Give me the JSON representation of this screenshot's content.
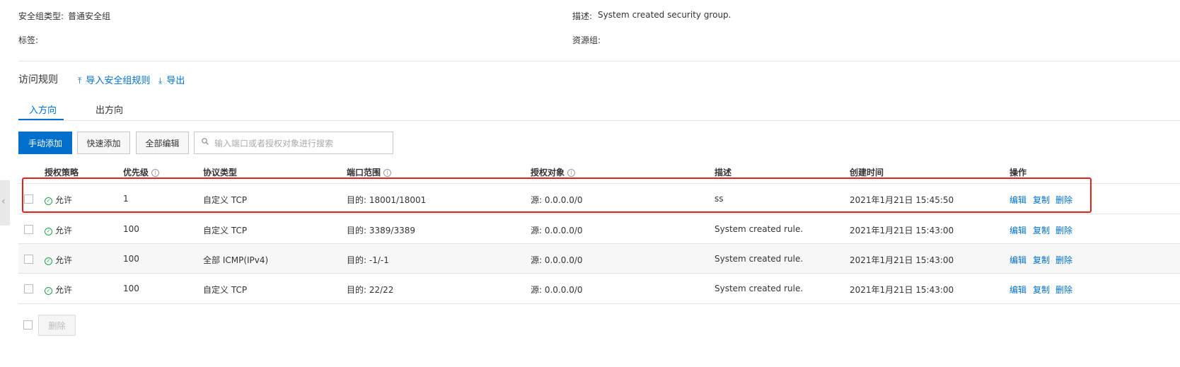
{
  "info": {
    "sg_type_label": "安全组类型:",
    "sg_type_value": "普通安全组",
    "desc_label": "描述:",
    "desc_value": "System created security group.",
    "tags_label": "标签:",
    "resgroup_label": "资源组:"
  },
  "rules": {
    "title": "访问规则",
    "import_label": "导入安全组规则",
    "export_label": "导出"
  },
  "tabs": [
    {
      "label": "入方向",
      "active": true
    },
    {
      "label": "出方向",
      "active": false
    }
  ],
  "toolbar": {
    "manual_add": "手动添加",
    "quick_add": "快速添加",
    "edit_all": "全部编辑",
    "search_placeholder": "输入端口或者授权对象进行搜索"
  },
  "table": {
    "headers": {
      "policy": "授权策略",
      "priority": "优先级",
      "protocol": "协议类型",
      "port": "端口范围",
      "source": "授权对象",
      "description": "描述",
      "created": "创建时间",
      "actions": "操作"
    },
    "rows": [
      {
        "policy": "允许",
        "priority": "1",
        "protocol": "自定义 TCP",
        "port": "目的: 18001/18001",
        "source": "源: 0.0.0.0/0",
        "description": "ss",
        "created": "2021年1月21日 15:45:50"
      },
      {
        "policy": "允许",
        "priority": "100",
        "protocol": "自定义 TCP",
        "port": "目的: 3389/3389",
        "source": "源: 0.0.0.0/0",
        "description": "System created rule.",
        "created": "2021年1月21日 15:43:00"
      },
      {
        "policy": "允许",
        "priority": "100",
        "protocol": "全部 ICMP(IPv4)",
        "port": "目的: -1/-1",
        "source": "源: 0.0.0.0/0",
        "description": "System created rule.",
        "created": "2021年1月21日 15:43:00"
      },
      {
        "policy": "允许",
        "priority": "100",
        "protocol": "自定义 TCP",
        "port": "目的: 22/22",
        "source": "源: 0.0.0.0/0",
        "description": "System created rule.",
        "created": "2021年1月21日 15:43:00"
      }
    ],
    "row_actions": {
      "edit": "编辑",
      "copy": "复制",
      "delete": "删除"
    }
  },
  "footer": {
    "delete_button": "删除"
  },
  "colors": {
    "accent": "#0070cc",
    "highlight": "#e0231c",
    "success": "#22a34a"
  },
  "icons": {
    "import": "upload-icon",
    "export": "download-icon",
    "search": "search-icon",
    "allow": "check-circle-icon",
    "info": "info-icon",
    "collapse": "chevron-left-icon"
  }
}
